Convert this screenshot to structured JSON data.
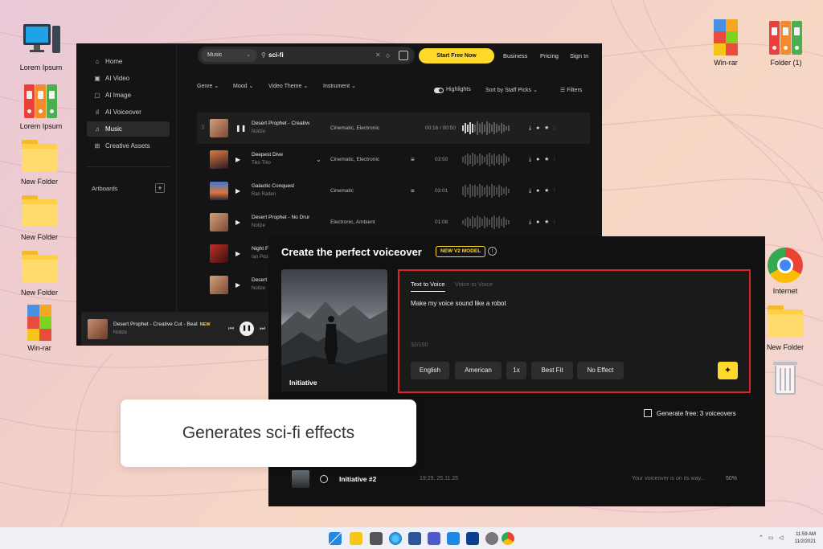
{
  "desktop": {
    "icons": [
      {
        "label": "Lorem Ipsum",
        "icon": "computer-icon"
      },
      {
        "label": "Lorem Ipsum",
        "icon": "binders-icon"
      },
      {
        "label": "New Folder",
        "icon": "folder-icon"
      },
      {
        "label": "New Folder",
        "icon": "folder-icon"
      },
      {
        "label": "New Folder",
        "icon": "folder-icon"
      },
      {
        "label": "Win-rar",
        "icon": "winrar-icon"
      },
      {
        "label": "Win-rar",
        "icon": "winrar-icon"
      },
      {
        "label": "Folder (1)",
        "icon": "binders-icon"
      },
      {
        "label": "Internet",
        "icon": "chrome-icon"
      },
      {
        "label": "New Folder",
        "icon": "folder-icon"
      },
      {
        "label": "",
        "icon": "recycle-bin-icon"
      }
    ]
  },
  "music_app": {
    "nav": [
      {
        "label": "Home",
        "icon": "home-icon"
      },
      {
        "label": "AI Video",
        "icon": "video-icon"
      },
      {
        "label": "AI Image",
        "icon": "image-icon"
      },
      {
        "label": "AI Voiceover",
        "icon": "voiceover-icon"
      },
      {
        "label": "Music",
        "icon": "music-note-icon",
        "active": true
      },
      {
        "label": "Creative Assets",
        "icon": "grid-icon"
      }
    ],
    "artboards_label": "Artboards",
    "search": {
      "category": "Music",
      "query": "sci-fi"
    },
    "cta_label": "Start Free Now",
    "top_links": [
      "Business",
      "Pricing",
      "Sign In"
    ],
    "filters": [
      "Genre",
      "Mood",
      "Video Theme",
      "Instrument"
    ],
    "highlights_label": "Highlights",
    "sort_label": "Sort by Staff Picks",
    "filters_label": "Filters",
    "tracks": [
      {
        "title": "Desert Prophet - Creative Cut",
        "artist": "Notize",
        "genre": "Cinematic, Electronic",
        "time": "00:16 / 00:50",
        "playing": true
      },
      {
        "title": "Deepest Dive",
        "artist": "Tiko Tiko",
        "genre": "Cinematic, Electronic",
        "time": "03:50"
      },
      {
        "title": "Galactic Conquest",
        "artist": "Ran Raiten",
        "genre": "Cinematic",
        "time": "03:01"
      },
      {
        "title": "Desert Prophet - No Drums",
        "artist": "Notize",
        "genre": "Electronic, Ambient",
        "time": "01:08"
      },
      {
        "title": "Night Fall",
        "artist": "Ian Post",
        "genre": "",
        "time": ""
      },
      {
        "title": "Desert",
        "artist": "Notize",
        "genre": "",
        "time": ""
      }
    ],
    "player": {
      "title": "Desert Prophet - Creative Cut - Beat",
      "badge": "NEW",
      "artist": "Notize"
    }
  },
  "voiceover_app": {
    "title": "Create the perfect voiceover",
    "badge": "NEW V2 MODEL",
    "image_label": "Initiative",
    "tabs": [
      "Text to Voice",
      "Voice to Voice"
    ],
    "prompt": "Make my voice sound like a robot",
    "char_count": "32/150",
    "options": [
      "English",
      "American",
      "1x",
      "Best Fit",
      "No Effect"
    ],
    "free_label": "Generate free: 3 voiceovers",
    "history": {
      "name": "Initiative #2",
      "time": "19:29, 25.11.25",
      "status": "Your voiceover is on its way...",
      "progress": "50%"
    }
  },
  "callout": "Generates sci-fi effects",
  "taskbar": {
    "time": "11:59 AM",
    "date": "11/2/2021"
  },
  "colors": {
    "accent": "#ffd92a",
    "highlight_border": "#d9242b"
  }
}
